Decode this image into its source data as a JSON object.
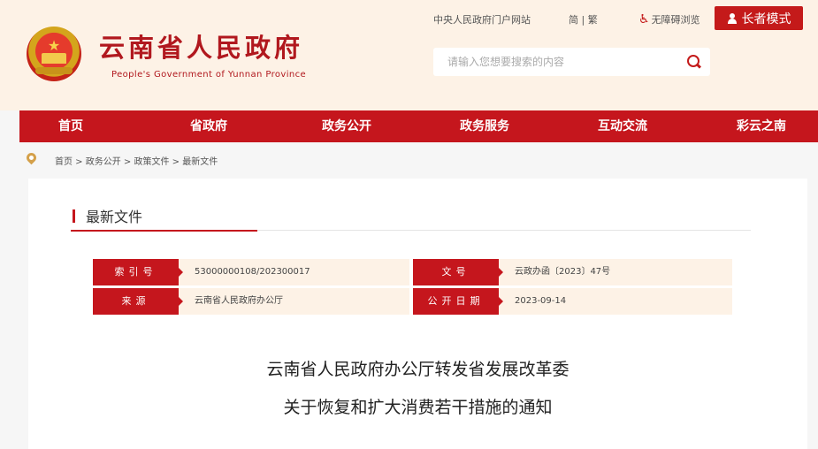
{
  "header": {
    "title": "云南省人民政府",
    "subtitle": "People's Government of Yunnan Province",
    "central_link": "中央人民政府门户网站",
    "lang_switch": "简 | 繁",
    "accessibility": "无障碍浏览",
    "elder_mode": "长者模式",
    "search_placeholder": "请输入您想要搜索的内容"
  },
  "nav": {
    "items": [
      "首页",
      "省政府",
      "政务公开",
      "政务服务",
      "互动交流",
      "彩云之南"
    ]
  },
  "breadcrumb": "首页 > 政务公开 > 政策文件 > 最新文件",
  "section": {
    "title": "最新文件"
  },
  "meta": {
    "index_label": "索引号",
    "index_value": "53000000108/202300017",
    "doc_no_label": "文号",
    "doc_no_value": "云政办函〔2023〕47号",
    "source_label": "来源",
    "source_value": "云南省人民政府办公厅",
    "date_label": "公开日期",
    "date_value": "2023-09-14"
  },
  "document": {
    "title_line1": "云南省人民政府办公厅转发省发展改革委",
    "title_line2": "关于恢复和扩大消费若干措施的通知"
  },
  "colors": {
    "brand_red": "#c5161d",
    "header_bg": "#fdf2e6"
  }
}
